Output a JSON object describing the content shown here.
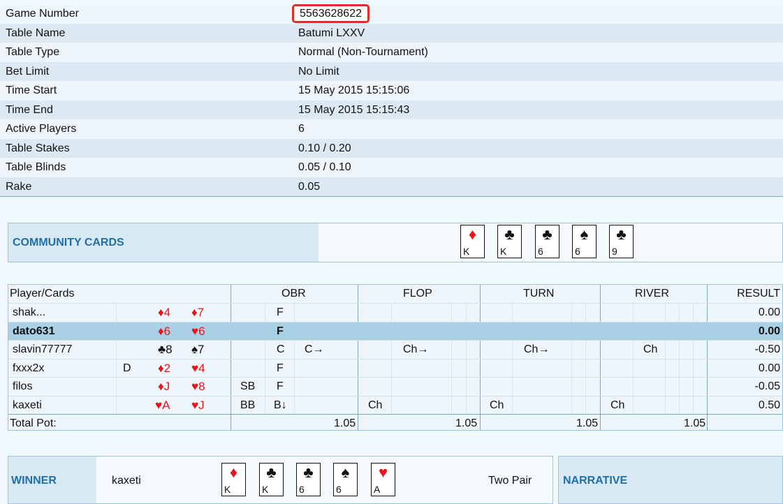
{
  "info": [
    {
      "label": "Game Number",
      "value": "5563628622"
    },
    {
      "label": "Table Name",
      "value": "Batumi LXXV"
    },
    {
      "label": "Table Type",
      "value": "Normal (Non-Tournament)"
    },
    {
      "label": "Bet Limit",
      "value": "No Limit"
    },
    {
      "label": "Time Start",
      "value": "15 May 2015 15:15:06"
    },
    {
      "label": "Time End",
      "value": "15 May 2015 15:15:43"
    },
    {
      "label": "Active Players",
      "value": "6"
    },
    {
      "label": "Table Stakes",
      "value": "0.10 / 0.20"
    },
    {
      "label": "Table Blinds",
      "value": "0.05 / 0.10"
    },
    {
      "label": "Rake",
      "value": "0.05"
    }
  ],
  "community": {
    "title": "COMMUNITY CARDS",
    "cards": [
      {
        "rank": "K",
        "suit": "♦",
        "color": "#e8141b"
      },
      {
        "rank": "K",
        "suit": "♣",
        "color": "#111111"
      },
      {
        "rank": "6",
        "suit": "♣",
        "color": "#111111"
      },
      {
        "rank": "6",
        "suit": "♠",
        "color": "#111111"
      },
      {
        "rank": "9",
        "suit": "♣",
        "color": "#111111"
      }
    ]
  },
  "grid": {
    "headers": {
      "player": "Player/Cards",
      "obr": "OBR",
      "flop": "FLOP",
      "turn": "TURN",
      "river": "RIVER",
      "result": "RESULT"
    },
    "players": [
      {
        "name": "shak...",
        "dealer": "",
        "c1": "♦4",
        "c1color": "#e8141b",
        "c2": "♦7",
        "c2color": "#e8141b",
        "pos": "",
        "obr1": "F",
        "obr2": "",
        "flop": "",
        "turn": "",
        "river": "",
        "result": "0.00"
      },
      {
        "name": "dato631",
        "dealer": "",
        "c1": "♦6",
        "c1color": "#e8141b",
        "c2": "♥6",
        "c2color": "#e8141b",
        "pos": "",
        "obr1": "F",
        "obr2": "",
        "flop": "",
        "turn": "",
        "river": "",
        "result": "0.00"
      },
      {
        "name": "slavin77777",
        "dealer": "",
        "c1": "♣8",
        "c1color": "#111111",
        "c2": "♠7",
        "c2color": "#111111",
        "pos": "",
        "obr1": "C",
        "obr2": "C→",
        "flop": "Ch→",
        "turn": "Ch→",
        "river": "Ch",
        "result": "-0.50"
      },
      {
        "name": "fxxx2x",
        "dealer": "D",
        "c1": "♦2",
        "c1color": "#e8141b",
        "c2": "♥4",
        "c2color": "#e8141b",
        "pos": "",
        "obr1": "F",
        "obr2": "",
        "flop": "",
        "turn": "",
        "river": "",
        "result": "0.00"
      },
      {
        "name": "filos",
        "dealer": "",
        "c1": "♦J",
        "c1color": "#e8141b",
        "c2": "♥8",
        "c2color": "#e8141b",
        "pos": "SB",
        "obr1": "F",
        "obr2": "",
        "flop": "",
        "turn": "",
        "river": "",
        "result": "-0.05"
      },
      {
        "name": "kaxeti",
        "dealer": "",
        "c1": "♥A",
        "c1color": "#e8141b",
        "c2": "♥J",
        "c2color": "#e8141b",
        "pos": "BB",
        "obr1": "B↓",
        "obr2": "",
        "flop": "Ch",
        "turn": "Ch",
        "river": "Ch",
        "result": "0.50"
      }
    ],
    "total": {
      "label": "Total Pot:",
      "obr": "1.05",
      "flop": "1.05",
      "turn": "1.05",
      "river": "1.05"
    }
  },
  "winner": {
    "title": "WINNER",
    "name": "kaxeti",
    "hand": "Two Pair",
    "cards": [
      {
        "rank": "K",
        "suit": "♦",
        "color": "#e8141b"
      },
      {
        "rank": "K",
        "suit": "♣",
        "color": "#111111"
      },
      {
        "rank": "6",
        "suit": "♣",
        "color": "#111111"
      },
      {
        "rank": "6",
        "suit": "♠",
        "color": "#111111"
      },
      {
        "rank": "A",
        "suit": "♥",
        "color": "#e8141b"
      }
    ]
  },
  "narrative": {
    "title": "NARRATIVE"
  }
}
